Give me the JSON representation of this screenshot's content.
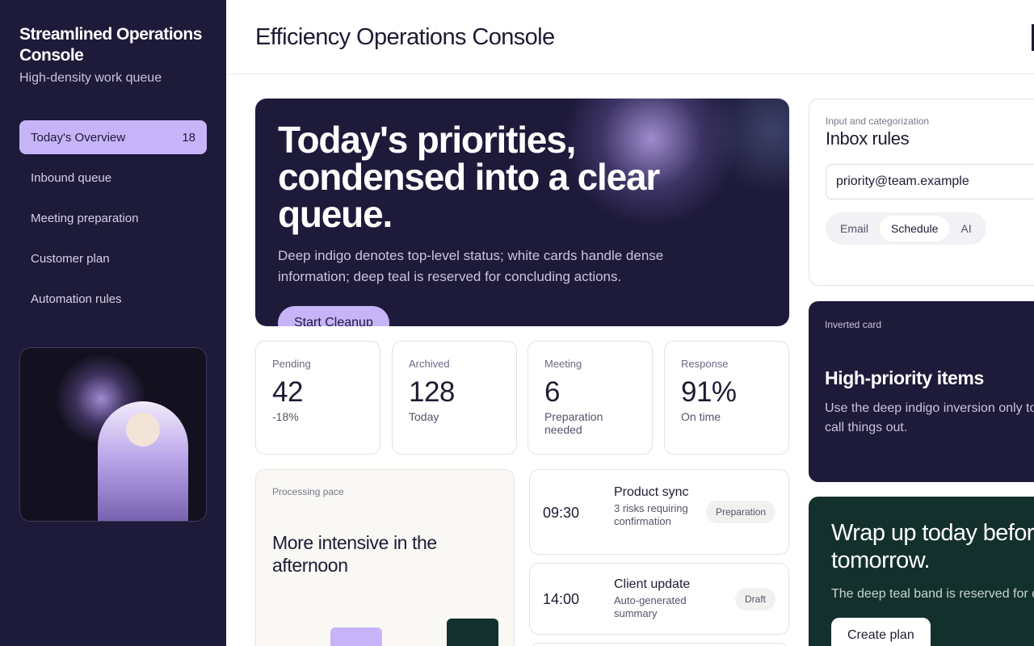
{
  "sidebar": {
    "brand_title": "Streamlined Operations Console",
    "brand_subtitle": "High-density work queue",
    "items": [
      {
        "label": "Today's Overview",
        "badge": "18"
      },
      {
        "label": "Inbound queue"
      },
      {
        "label": "Meeting preparation"
      },
      {
        "label": "Customer plan"
      },
      {
        "label": "Automation rules"
      }
    ]
  },
  "header": {
    "title": "Efficiency Operations Console"
  },
  "hero": {
    "title": "Today's priorities, condensed into a clear queue.",
    "description": "Deep indigo denotes top-level status; white cards handle dense information; deep teal is reserved for concluding actions.",
    "button": "Start Cleanup"
  },
  "stats": [
    {
      "label": "Pending",
      "value": "42",
      "sub": "-18%"
    },
    {
      "label": "Archived",
      "value": "128",
      "sub": "Today"
    },
    {
      "label": "Meeting",
      "value": "6",
      "sub": "Preparation needed"
    },
    {
      "label": "Response",
      "value": "91%",
      "sub": "On time"
    }
  ],
  "pace": {
    "label": "Processing pace",
    "title": "More intensive in the afternoon"
  },
  "schedule": [
    {
      "time": "09:30",
      "title": "Product sync",
      "desc": "3 risks requiring confirmation",
      "tag": "Preparation"
    },
    {
      "time": "14:00",
      "title": "Client update",
      "desc": "Auto-generated summary",
      "tag": "Draft"
    }
  ],
  "rules": {
    "label": "Input and categorization",
    "title": "Inbox rules",
    "input_value": "priority@team.example",
    "segments": [
      "Email",
      "Schedule",
      "AI"
    ],
    "active_segment": "Schedule"
  },
  "inverted": {
    "label": "Inverted card",
    "title": "High-priority items",
    "text": "Use the deep indigo inversion only to call things out."
  },
  "wrap": {
    "title": "Wrap up today before tomorrow.",
    "text": "The deep teal band is reserved for concluding actions.",
    "button": "Create plan"
  },
  "colors": {
    "indigo": "#1d1a3a",
    "lavender": "#c7b4f8",
    "teal": "#13302d"
  }
}
